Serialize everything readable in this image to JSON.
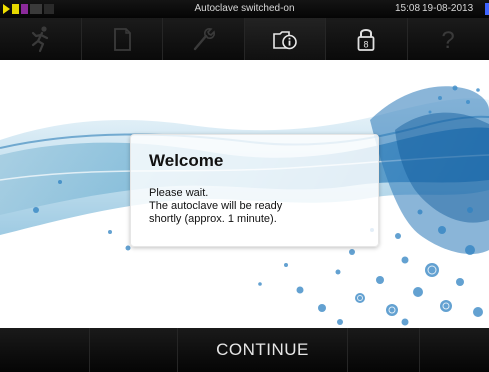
{
  "status_bar": {
    "title": "Autoclave switched-on",
    "time": "15:08",
    "date": "19-08-2013"
  },
  "toolbar": {
    "buttons": [
      {
        "icon": "running-person-icon"
      },
      {
        "icon": "document-icon"
      },
      {
        "icon": "wrench-icon"
      },
      {
        "icon": "info-folder-icon"
      },
      {
        "icon": "lock-icon"
      },
      {
        "icon": "help-icon"
      }
    ],
    "lock_level": "8",
    "help_glyph": "?"
  },
  "dialog": {
    "title": "Welcome",
    "lines": [
      "Please wait.",
      "The autoclave will be ready",
      "shortly (approx. 1 minute)."
    ]
  },
  "bottom_bar": {
    "continue_label": "CONTINUE"
  }
}
